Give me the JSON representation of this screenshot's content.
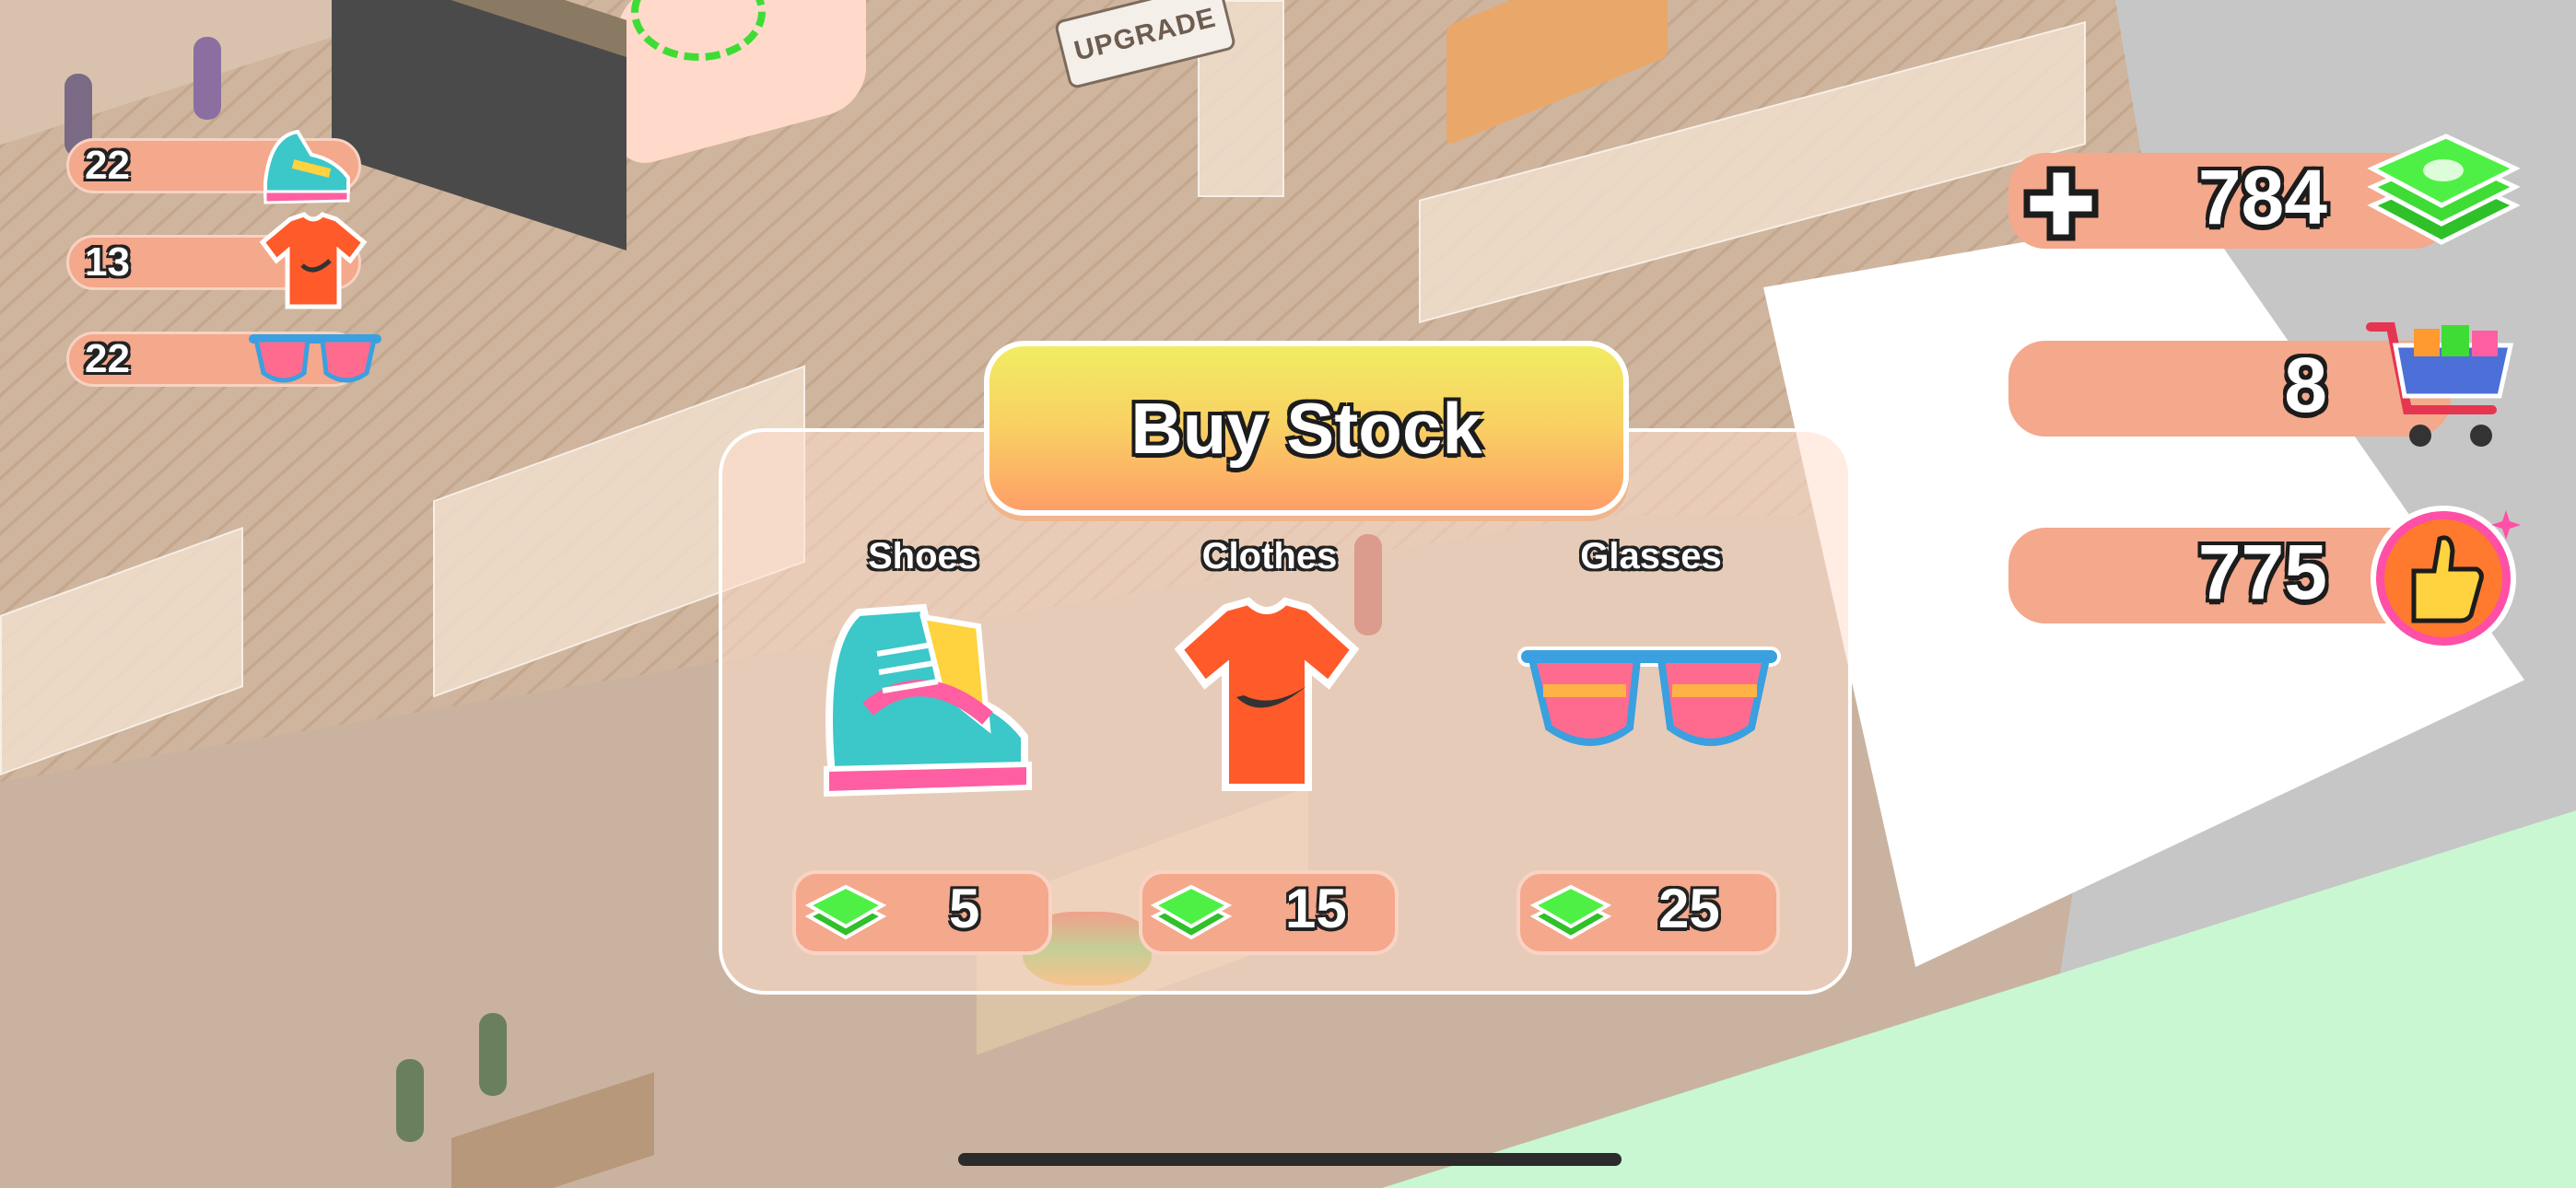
{
  "scene": {
    "sign_text": "UPGRADE"
  },
  "inventory": [
    {
      "count": "22",
      "icon": "sneaker-icon"
    },
    {
      "count": "13",
      "icon": "tshirt-icon"
    },
    {
      "count": "22",
      "icon": "sunglasses-icon"
    }
  ],
  "hud": {
    "add_money_icon": "plus-icon",
    "money": "784",
    "customers": "8",
    "likes": "775"
  },
  "buy_stock": {
    "title": "Buy Stock",
    "items": [
      {
        "label": "Shoes",
        "price": "5",
        "icon": "sneaker-icon"
      },
      {
        "label": "Clothes",
        "price": "15",
        "icon": "tshirt-icon"
      },
      {
        "label": "Glasses",
        "price": "25",
        "icon": "sunglasses-icon"
      }
    ]
  },
  "colors": {
    "bar": "#f4a88c",
    "title_top": "#f1ec63",
    "title_bottom": "#ff9e68",
    "cash_green": "#3fdc35"
  }
}
